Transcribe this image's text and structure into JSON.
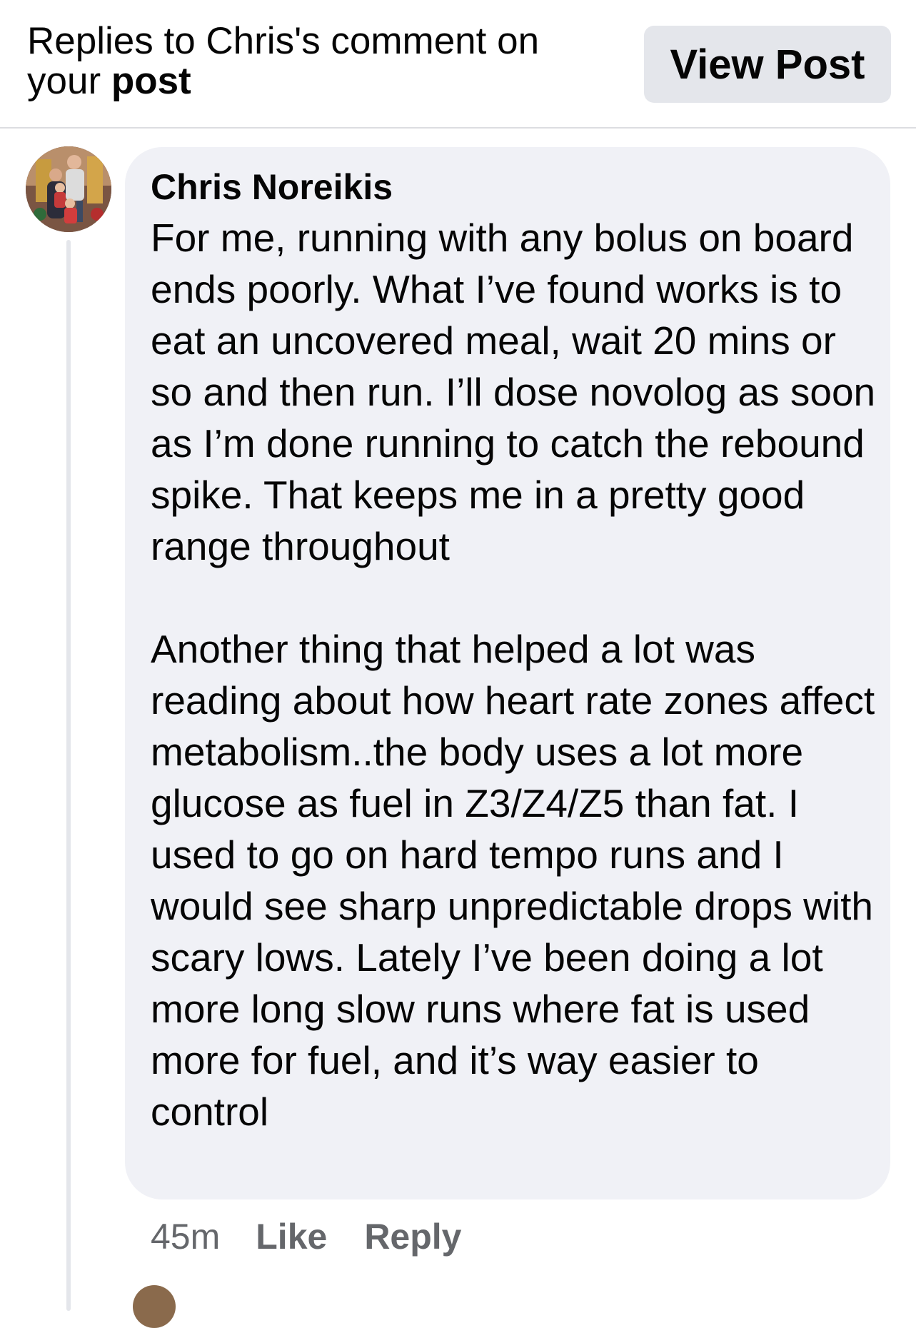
{
  "header": {
    "title_prefix": "Replies to Chris's comment on your ",
    "title_bold": "post",
    "view_post_label": "View Post"
  },
  "comment": {
    "author": "Chris Noreikis",
    "paragraph_1": "For me, running with any bolus on board ends poorly.  What I’ve found works is to eat an uncovered meal, wait 20 mins or so and then run.  I’ll dose novolog as soon as I’m done running to catch the rebound spike.  That keeps me in a pretty good range throughout",
    "paragraph_2": "Another thing that helped a lot was reading about how heart rate zones affect metabolism..the body uses a lot more glucose as fuel in Z3/Z4/Z5 than fat.  I used to go on hard tempo runs and I would see sharp unpredictable drops with scary lows.  Lately I’ve been doing a lot more long slow runs where fat is used more for fuel, and it’s way easier to control",
    "time": "45m",
    "like_label": "Like",
    "reply_label": "Reply"
  },
  "icons": {
    "avatar": "user-photo-avatar"
  }
}
